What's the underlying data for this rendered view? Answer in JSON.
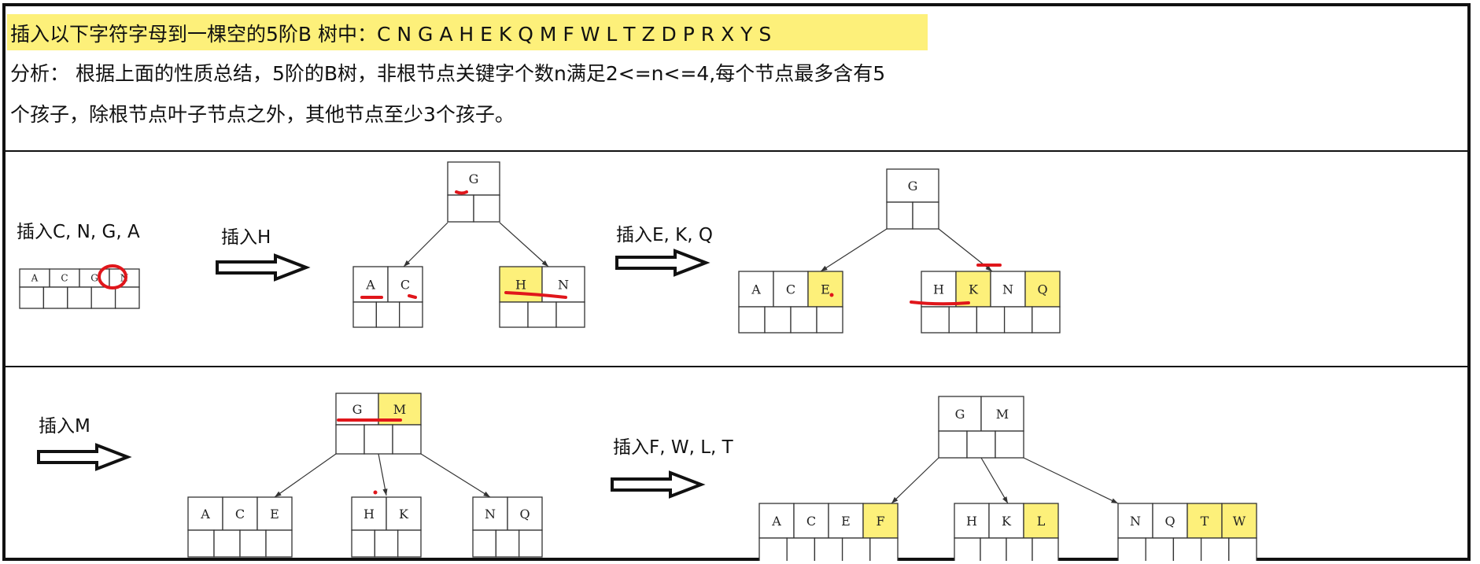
{
  "header": {
    "title": "插入以下字符字母到一棵空的5阶B 树中：C N G A H E K Q M F W L T Z D P R X Y S",
    "analysis_line1": "分析： 根据上面的性质总结，5阶的B树，非根节点关键字个数n满足2<=n<=4,每个节点最多含有5",
    "analysis_line2": "个孩子，除根节点叶子节点之外，其他节点至少3个孩子。",
    "highlight_color": "#fdf07a"
  },
  "colors": {
    "highlight": "#fdf07a",
    "mark": "#e0161b",
    "border": "#111111"
  },
  "steps": [
    {
      "label": "插入C, N, G, A"
    },
    {
      "label": "插入H"
    },
    {
      "label": "插入E, K, Q"
    },
    {
      "label": "插入M"
    },
    {
      "label": "插入F, W, L, T"
    }
  ],
  "trees": {
    "step1": {
      "node": {
        "keys": [
          "A",
          "C",
          "G",
          "N"
        ],
        "highlight": []
      }
    },
    "step2": {
      "root": {
        "keys": [
          "G"
        ]
      },
      "children": [
        {
          "keys": [
            "A",
            "C"
          ],
          "highlight": []
        },
        {
          "keys": [
            "H",
            "N"
          ],
          "highlight": [
            "H"
          ]
        }
      ]
    },
    "step3": {
      "root": {
        "keys": [
          "G"
        ]
      },
      "children": [
        {
          "keys": [
            "A",
            "C",
            "E"
          ],
          "highlight": [
            "E"
          ]
        },
        {
          "keys": [
            "H",
            "K",
            "N",
            "Q"
          ],
          "highlight": [
            "K",
            "Q"
          ]
        }
      ]
    },
    "step4": {
      "root": {
        "keys": [
          "G",
          "M"
        ],
        "highlight": [
          "M"
        ]
      },
      "children": [
        {
          "keys": [
            "A",
            "C",
            "E"
          ],
          "highlight": []
        },
        {
          "keys": [
            "H",
            "K"
          ],
          "highlight": []
        },
        {
          "keys": [
            "N",
            "Q"
          ],
          "highlight": []
        }
      ]
    },
    "step5": {
      "root": {
        "keys": [
          "G",
          "M"
        ],
        "highlight": []
      },
      "children": [
        {
          "keys": [
            "A",
            "C",
            "E",
            "F"
          ],
          "highlight": [
            "F"
          ]
        },
        {
          "keys": [
            "H",
            "K",
            "L"
          ],
          "highlight": [
            "L"
          ]
        },
        {
          "keys": [
            "N",
            "Q",
            "T",
            "W"
          ],
          "highlight": [
            "T",
            "W"
          ]
        }
      ]
    }
  }
}
